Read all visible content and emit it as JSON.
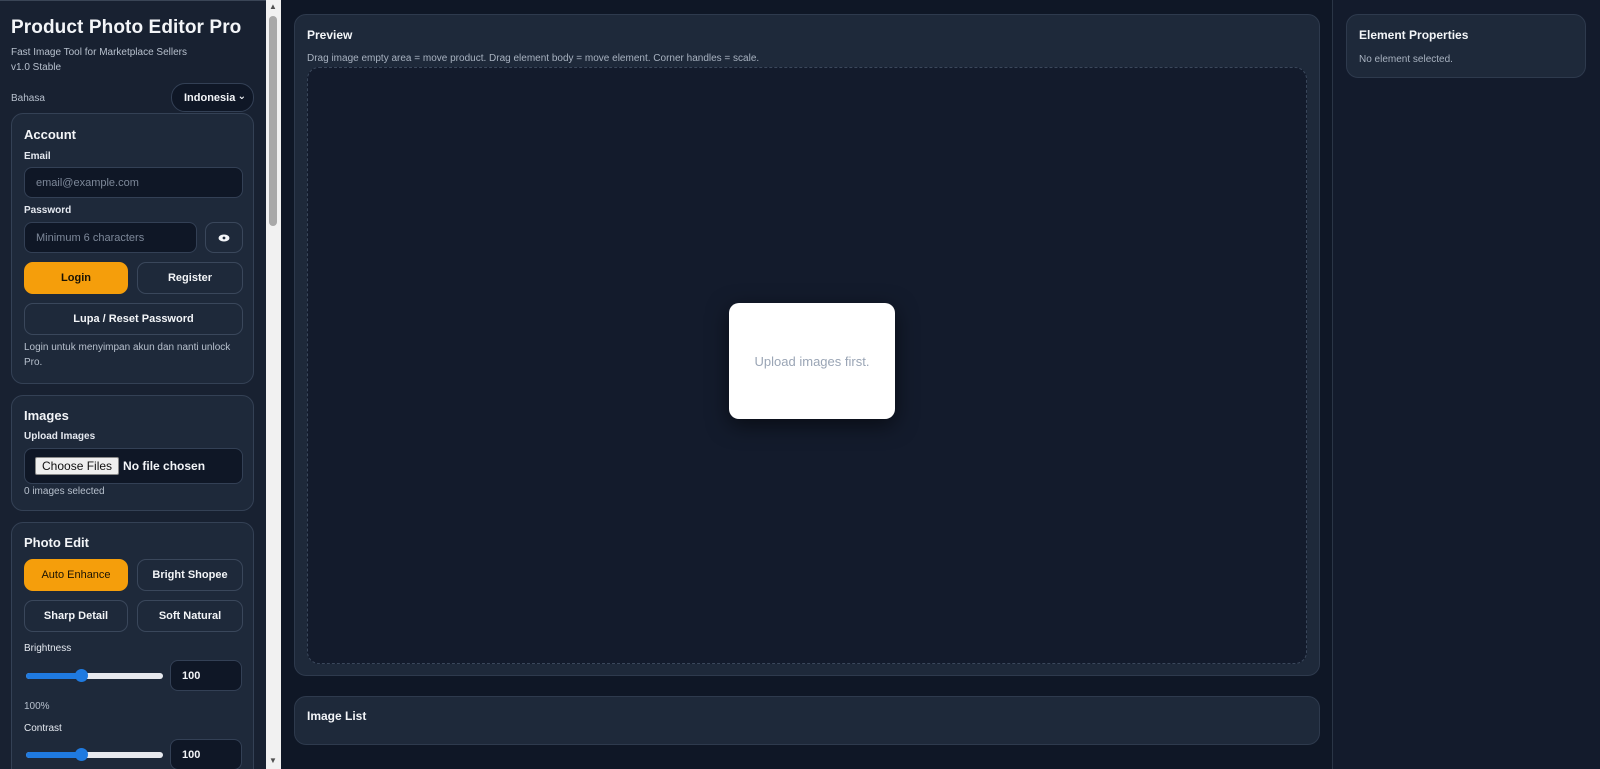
{
  "app": {
    "title": "Product Photo Editor Pro",
    "subtitle": "Fast Image Tool for Marketplace Sellers",
    "version": "v1.0 Stable"
  },
  "language": {
    "label": "Bahasa",
    "selected": "Indonesia"
  },
  "account": {
    "title": "Account",
    "email_label": "Email",
    "email_placeholder": "email@example.com",
    "password_label": "Password",
    "password_placeholder": "Minimum 6 characters",
    "show_password_icon": "eye-icon",
    "login_label": "Login",
    "register_label": "Register",
    "reset_label": "Lupa / Reset Password",
    "note": "Login untuk menyimpan akun dan nanti unlock Pro."
  },
  "images": {
    "title": "Images",
    "upload_label": "Upload Images",
    "choose_label": "Choose Files",
    "file_status": "No file chosen",
    "count_text": "0 images selected"
  },
  "photo_edit": {
    "title": "Photo Edit",
    "presets": [
      "Auto Enhance",
      "Bright Shopee",
      "Sharp Detail",
      "Soft Natural"
    ],
    "active_preset": "Auto Enhance",
    "brightness": {
      "label": "Brightness",
      "value": "100",
      "percent": "100%",
      "fraction": 0.4
    },
    "contrast": {
      "label": "Contrast",
      "value": "100",
      "fraction": 0.4
    }
  },
  "preview": {
    "title": "Preview",
    "hint": "Drag image empty area = move product. Drag element body = move element. Corner handles = scale.",
    "placeholder": "Upload images first."
  },
  "image_list": {
    "title": "Image List"
  },
  "element_properties": {
    "title": "Element Properties",
    "empty_text": "No element selected."
  },
  "colors": {
    "accent": "#f59e0b",
    "background": "#0f1726",
    "card": "#1e293a",
    "slider": "#1f7ae0"
  }
}
